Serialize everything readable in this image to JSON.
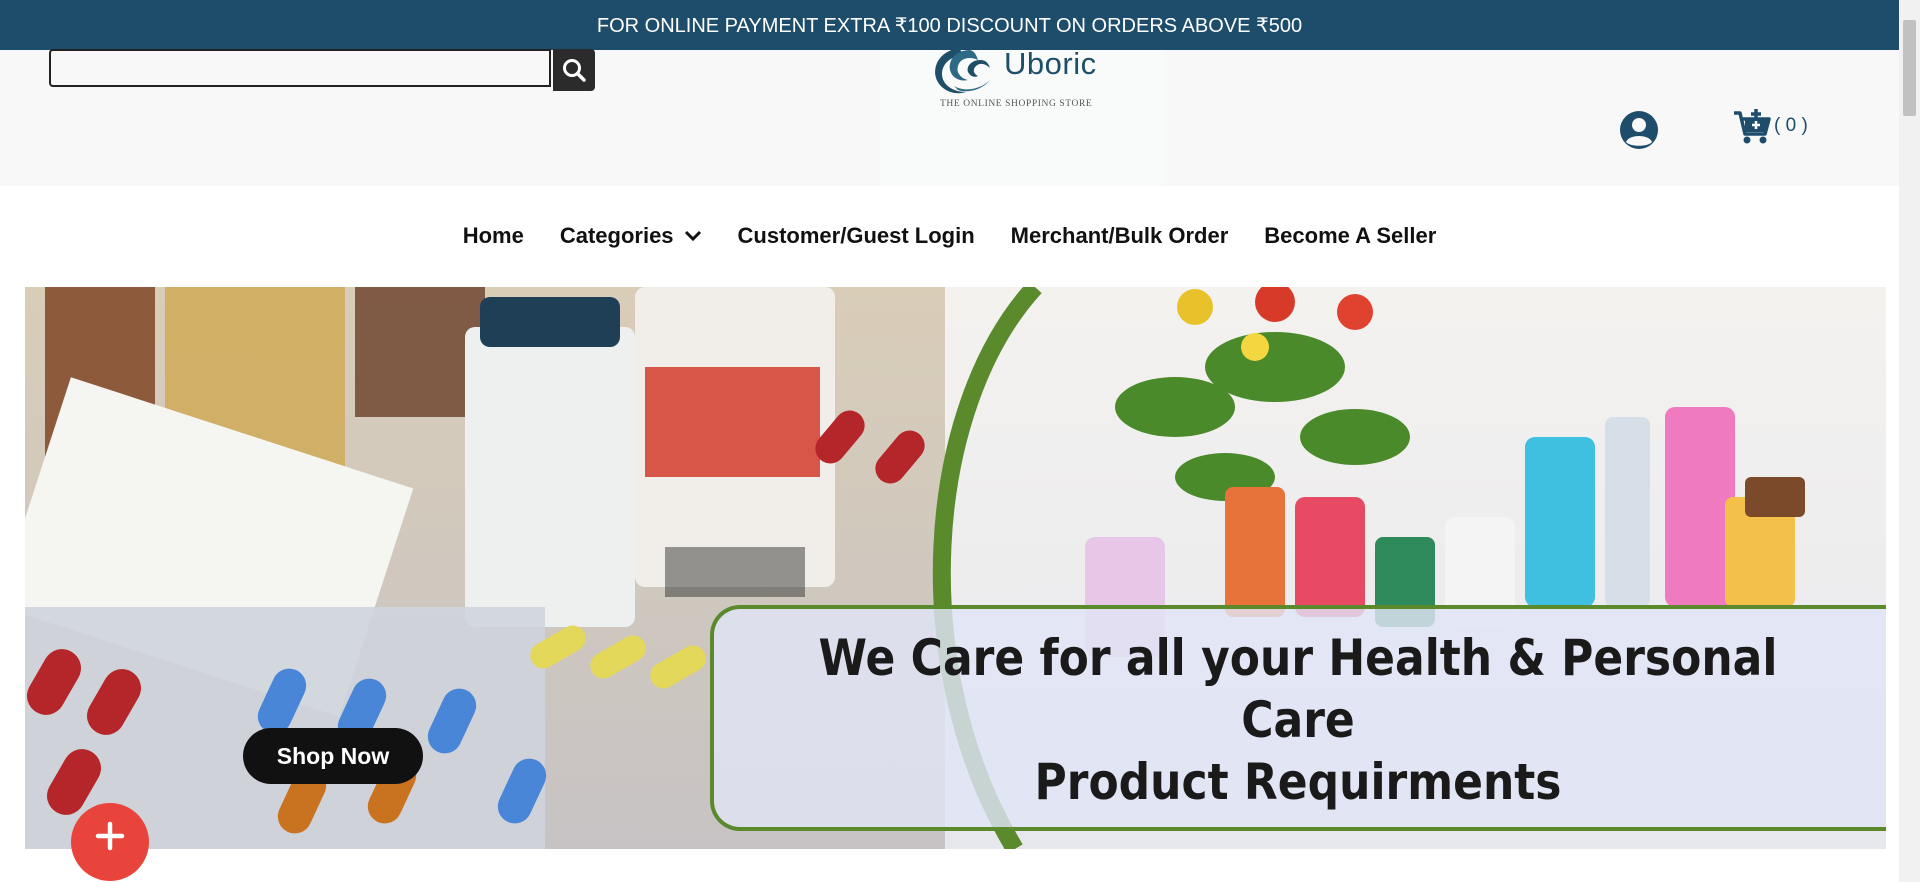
{
  "announcement": "FOR ONLINE PAYMENT EXTRA ₹100 DISCOUNT ON ORDERS ABOVE ₹500",
  "search": {
    "value": "",
    "placeholder": ""
  },
  "logo": {
    "brand": "Uboric",
    "tagline": "THE ONLINE SHOPPING STORE"
  },
  "cart": {
    "count": "( 0 )"
  },
  "nav": {
    "home": "Home",
    "categories": "Categories",
    "customer_login": "Customer/Guest Login",
    "merchant": "Merchant/Bulk Order",
    "seller": "Become A Seller"
  },
  "hero": {
    "headline_line1": "We Care for all your Health & Personal Care",
    "headline_line2": "Product Requirments",
    "cta": "Shop Now"
  },
  "colors": {
    "topbar": "#1e4d6c",
    "brand": "#1f4f68",
    "fab": "#e8443c",
    "panel_border": "#5b8a2d"
  },
  "icons": [
    "search-icon",
    "user-icon",
    "cart-icon",
    "chevron-down-icon",
    "plus-icon"
  ]
}
